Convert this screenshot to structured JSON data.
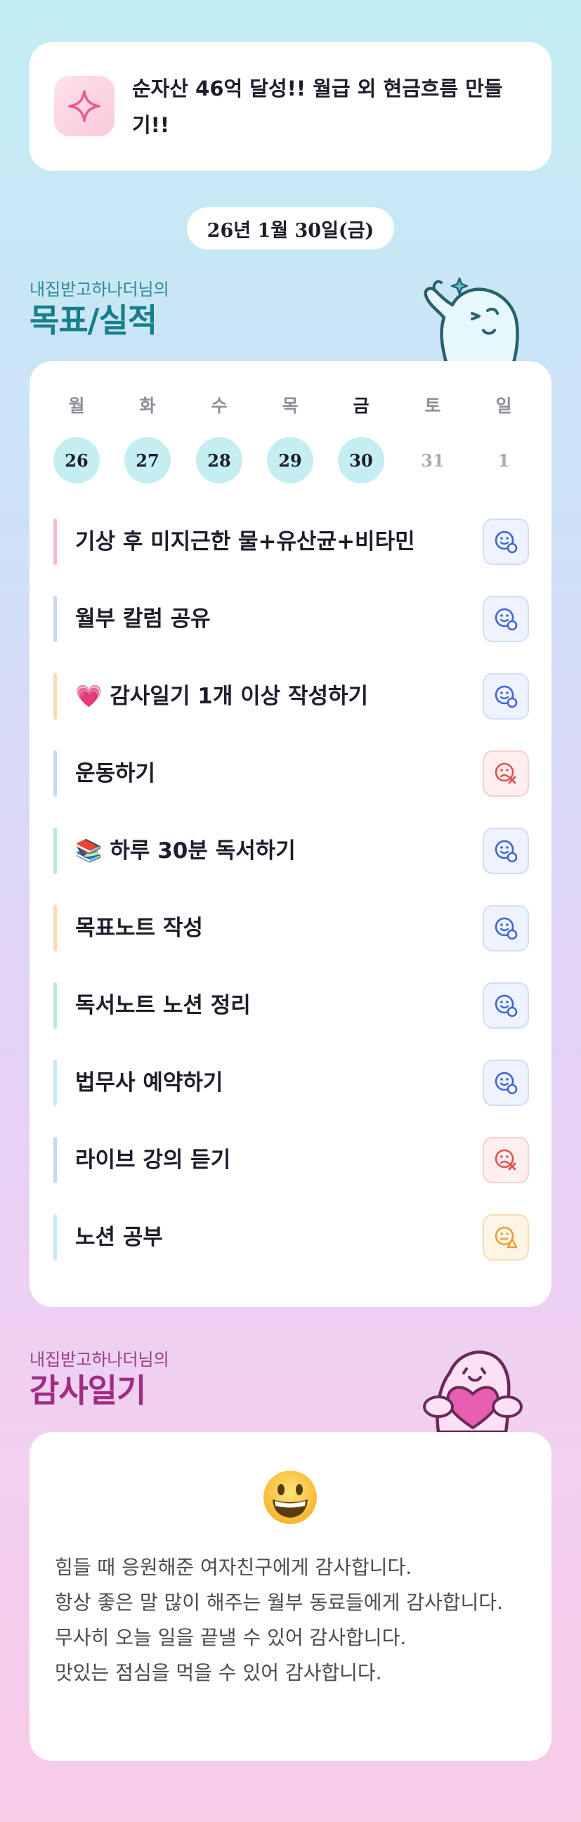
{
  "goal_banner": {
    "icon": "sparkle-icon",
    "text": "순자산 46억 달성!! 월급 외 현금흐름 만들기!!"
  },
  "date_label": "26년 1월 30일(금)",
  "goals_section": {
    "subtitle": "내집받고하나더님의",
    "title": "목표/실적"
  },
  "week": {
    "weekdays": [
      "월",
      "화",
      "수",
      "목",
      "금",
      "토",
      "일"
    ],
    "today_index": 4,
    "days": [
      {
        "num": "26",
        "active": true
      },
      {
        "num": "27",
        "active": true
      },
      {
        "num": "28",
        "active": true
      },
      {
        "num": "29",
        "active": true
      },
      {
        "num": "30",
        "active": true
      },
      {
        "num": "31",
        "active": false
      },
      {
        "num": "1",
        "active": false
      }
    ]
  },
  "tasks": [
    {
      "label": "기상 후 미지근한 물+유산균+비타민",
      "status": "done",
      "bar_color": "#f6b8d9"
    },
    {
      "label": "월부 칼럼 공유",
      "status": "done",
      "bar_color": "#c8d6f7"
    },
    {
      "label": "💗 감사일기 1개 이상 작성하기",
      "status": "done",
      "bar_color": "#fbdcae"
    },
    {
      "label": "운동하기",
      "status": "fail",
      "bar_color": "#c8d6f7"
    },
    {
      "label": "📚 하루 30분 독서하기",
      "status": "done",
      "bar_color": "#b8ecd6"
    },
    {
      "label": "목표노트 작성",
      "status": "done",
      "bar_color": "#fbdcae"
    },
    {
      "label": "독서노트 노션 정리",
      "status": "done",
      "bar_color": "#b8ecd6"
    },
    {
      "label": "법무사 예약하기",
      "status": "done",
      "bar_color": "#c6ecf2"
    },
    {
      "label": "라이브 강의 듣기",
      "status": "fail",
      "bar_color": "#c8d6f7"
    },
    {
      "label": "노션 공부",
      "status": "partial",
      "bar_color": "#c6ecf2"
    }
  ],
  "status_colors": {
    "done": "#3f63d9",
    "fail": "#e2504a",
    "partial": "#ec9a2e"
  },
  "thanks_section": {
    "subtitle": "내집받고하나더님의",
    "title": "감사일기",
    "emoji": "grinning-face-icon",
    "lines": [
      "힘들 때 응원해준 여자친구에게 감사합니다.",
      "항상 좋은 말 많이 해주는 월부 동료들에게 감사합니다.",
      "무사히 오늘 일을 끝낼 수 있어 감사합니다.",
      "맛있는 점심을 먹을 수 있어 감사합니다."
    ]
  }
}
